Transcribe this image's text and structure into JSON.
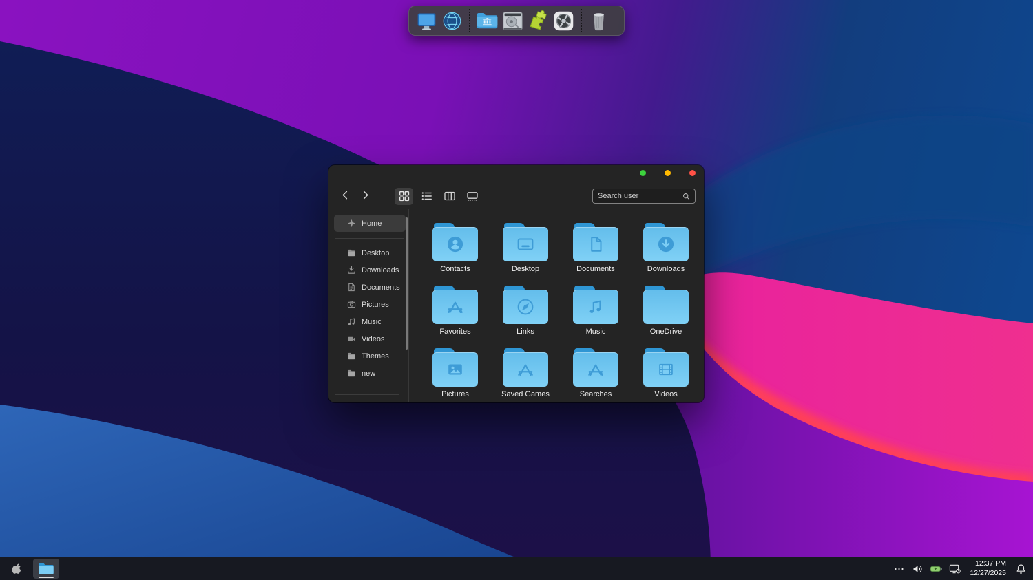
{
  "dock": {
    "items": [
      {
        "icon": "display-icon"
      },
      {
        "icon": "network-globe-icon"
      },
      {
        "separator": true
      },
      {
        "icon": "library-folder-icon"
      },
      {
        "icon": "harddrive-icon"
      },
      {
        "icon": "puzzle-icon"
      },
      {
        "icon": "settings-icon"
      },
      {
        "separator": true
      },
      {
        "icon": "trash-icon"
      }
    ]
  },
  "window": {
    "traffic_lights": [
      {
        "name": "green",
        "color": "#3dd33d"
      },
      {
        "name": "yellow",
        "color": "#ffb900"
      },
      {
        "name": "red",
        "color": "#ff5146"
      }
    ],
    "toolbar": {
      "nav": [
        {
          "icon": "back-icon"
        },
        {
          "icon": "forward-icon"
        }
      ],
      "views": [
        {
          "icon": "grid-view-icon",
          "active": true
        },
        {
          "icon": "list-view-icon"
        },
        {
          "icon": "columns-view-icon"
        },
        {
          "icon": "gallery-view-icon"
        }
      ],
      "search_placeholder": "Search user",
      "search_icon": "search-icon"
    },
    "sidebar": {
      "items": [
        {
          "label": "Home",
          "icon": "star-icon",
          "active": true
        },
        {
          "divider": true
        },
        {
          "label": "Desktop",
          "icon": "folder-small-icon"
        },
        {
          "label": "Downloads",
          "icon": "download-small-icon"
        },
        {
          "label": "Documents",
          "icon": "document-small-icon"
        },
        {
          "label": "Pictures",
          "icon": "camera-small-icon"
        },
        {
          "label": "Music",
          "icon": "music-small-icon"
        },
        {
          "label": "Videos",
          "icon": "videocam-small-icon"
        },
        {
          "label": "Themes",
          "icon": "folder-small-icon"
        },
        {
          "label": "new",
          "icon": "folder-small-icon"
        }
      ]
    },
    "folders": {
      "items": [
        {
          "label": "Contacts",
          "glyph": "contact-glyph"
        },
        {
          "label": "Desktop",
          "glyph": "desktop-glyph"
        },
        {
          "label": "Documents",
          "glyph": "document-glyph"
        },
        {
          "label": "Downloads",
          "glyph": "download-glyph"
        },
        {
          "label": "Favorites",
          "glyph": "appstore-glyph"
        },
        {
          "label": "Links",
          "glyph": "compass-glyph"
        },
        {
          "label": "Music",
          "glyph": "music-glyph"
        },
        {
          "label": "OneDrive",
          "glyph": "none-glyph"
        },
        {
          "label": "Pictures",
          "glyph": "picture-glyph"
        },
        {
          "label": "Saved Games",
          "glyph": "appstore-glyph"
        },
        {
          "label": "Searches",
          "glyph": "appstore-glyph"
        },
        {
          "label": "Videos",
          "glyph": "film-glyph"
        }
      ]
    }
  },
  "taskbar": {
    "start": {
      "icon": "apple-icon"
    },
    "apps": [
      {
        "icon": "explorer-folder-icon",
        "active": true
      }
    ],
    "tray": {
      "icons": [
        {
          "icon": "ellipsis-icon"
        },
        {
          "icon": "volume-icon"
        },
        {
          "icon": "battery-icon"
        },
        {
          "icon": "display-tray-icon"
        }
      ],
      "time": "12:37 PM",
      "date": "12/27/2025",
      "bell_icon": "bell-icon"
    }
  },
  "colors": {
    "folder_tab": "#2f96d4",
    "folder_body": "#7ccdf4",
    "folder_glyph": "#3e9cd6",
    "traffic_green": "#3dd33d",
    "traffic_yellow": "#ffb900",
    "traffic_red": "#ff5146"
  }
}
